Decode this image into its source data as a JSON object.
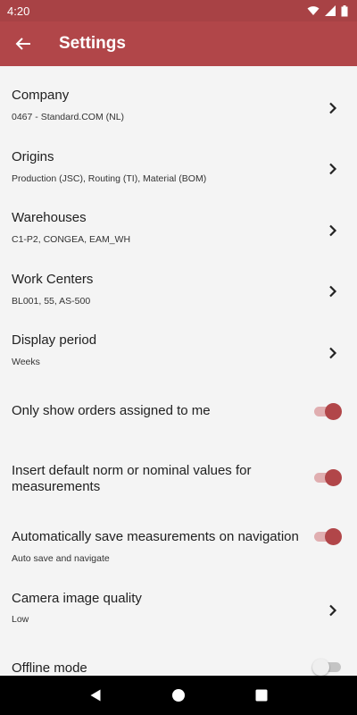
{
  "status_bar": {
    "time": "4:20",
    "icons": [
      "wifi-icon",
      "signal-icon",
      "battery-icon"
    ]
  },
  "app_bar": {
    "title": "Settings",
    "back_icon": "arrow-left-icon"
  },
  "settings": {
    "company": {
      "title": "Company",
      "value": "0467  -  Standard.COM (NL)"
    },
    "origins": {
      "title": "Origins",
      "value": "Production (JSC), Routing (TI), Material (BOM)"
    },
    "warehouses": {
      "title": "Warehouses",
      "value": "C1-P2, CONGEA, EAM_WH"
    },
    "work_centers": {
      "title": "Work Centers",
      "value": "BL001, 55, AS-500"
    },
    "display_period": {
      "title": "Display period",
      "value": "Weeks"
    },
    "only_assigned": {
      "title": "Only show orders assigned to me",
      "enabled": true
    },
    "insert_default": {
      "title_line1": "Insert default norm or nominal values for",
      "title_line2": "measurements",
      "enabled": true
    },
    "auto_save": {
      "title": "Automatically save measurements on navigation",
      "value": "Auto save and navigate",
      "enabled": true
    },
    "camera_quality": {
      "title": "Camera image quality",
      "value": "Low"
    },
    "offline_mode": {
      "title": "Offline mode",
      "enabled": false
    }
  },
  "colors": {
    "primary": "#b14649",
    "status_bar": "#a84245",
    "background": "#f4f4f4"
  },
  "nav_bar": {
    "icons": [
      "back-triangle-icon",
      "home-circle-icon",
      "recents-square-icon"
    ]
  }
}
